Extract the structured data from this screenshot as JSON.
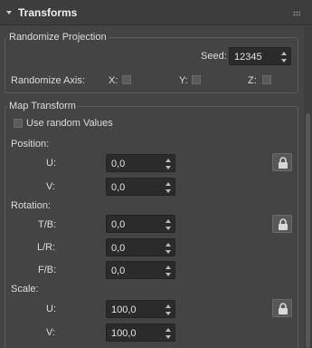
{
  "rollout": {
    "title": "Transforms"
  },
  "randomize_projection": {
    "title": "Randomize Projection",
    "seed_label": "Seed:",
    "seed_value": "12345",
    "axis_label": "Randomize Axis:",
    "axis_x": "X:",
    "axis_y": "Y:",
    "axis_z": "Z:"
  },
  "map_transform": {
    "title": "Map Transform",
    "use_random_label": "Use random Values",
    "position": {
      "label": "Position:",
      "u_label": "U:",
      "u_value": "0,0",
      "v_label": "V:",
      "v_value": "0,0"
    },
    "rotation": {
      "label": "Rotation:",
      "tb_label": "T/B:",
      "tb_value": "0,0",
      "lr_label": "L/R:",
      "lr_value": "0,0",
      "fb_label": "F/B:",
      "fb_value": "0,0"
    },
    "scale": {
      "label": "Scale:",
      "u_label": "U:",
      "u_value": "100,0",
      "v_label": "V:",
      "v_value": "100,0"
    }
  },
  "icons": {
    "collapse": "triangle-down-icon",
    "grip": "grip-icon",
    "lock": "lock-icon"
  }
}
